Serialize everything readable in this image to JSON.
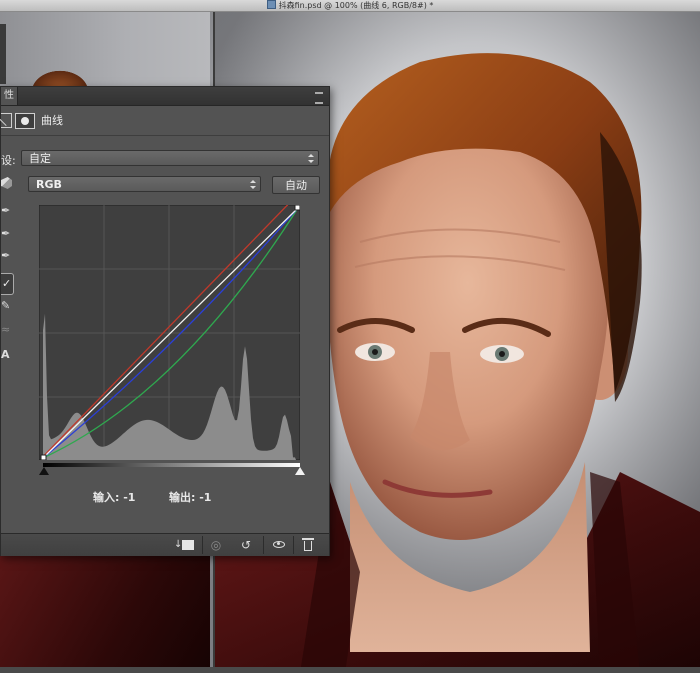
{
  "document": {
    "title": "抖森fin.psd @ 100% (曲线 6, RGB/8#) *"
  },
  "panel": {
    "tab_label": "性",
    "adjustment_type": "曲线",
    "preset_label": "设:",
    "preset_value": "自定",
    "channel_value": "RGB",
    "auto_label": "自动",
    "input_readout": "输入: -1",
    "output_readout": "输出: -1"
  },
  "curves": {
    "grid": true,
    "channel_colors": {
      "rgb": "#f2f2f2",
      "red": "#c0392b",
      "green": "#2fa84f",
      "blue": "#2b3fd6"
    },
    "histogram_color": "#8c8c8c"
  },
  "colors": {
    "panel_bg": "#535353",
    "canvas_bg": "#c9cacd",
    "jacket": "#4a0f0f",
    "hair": "#8a3f17"
  }
}
